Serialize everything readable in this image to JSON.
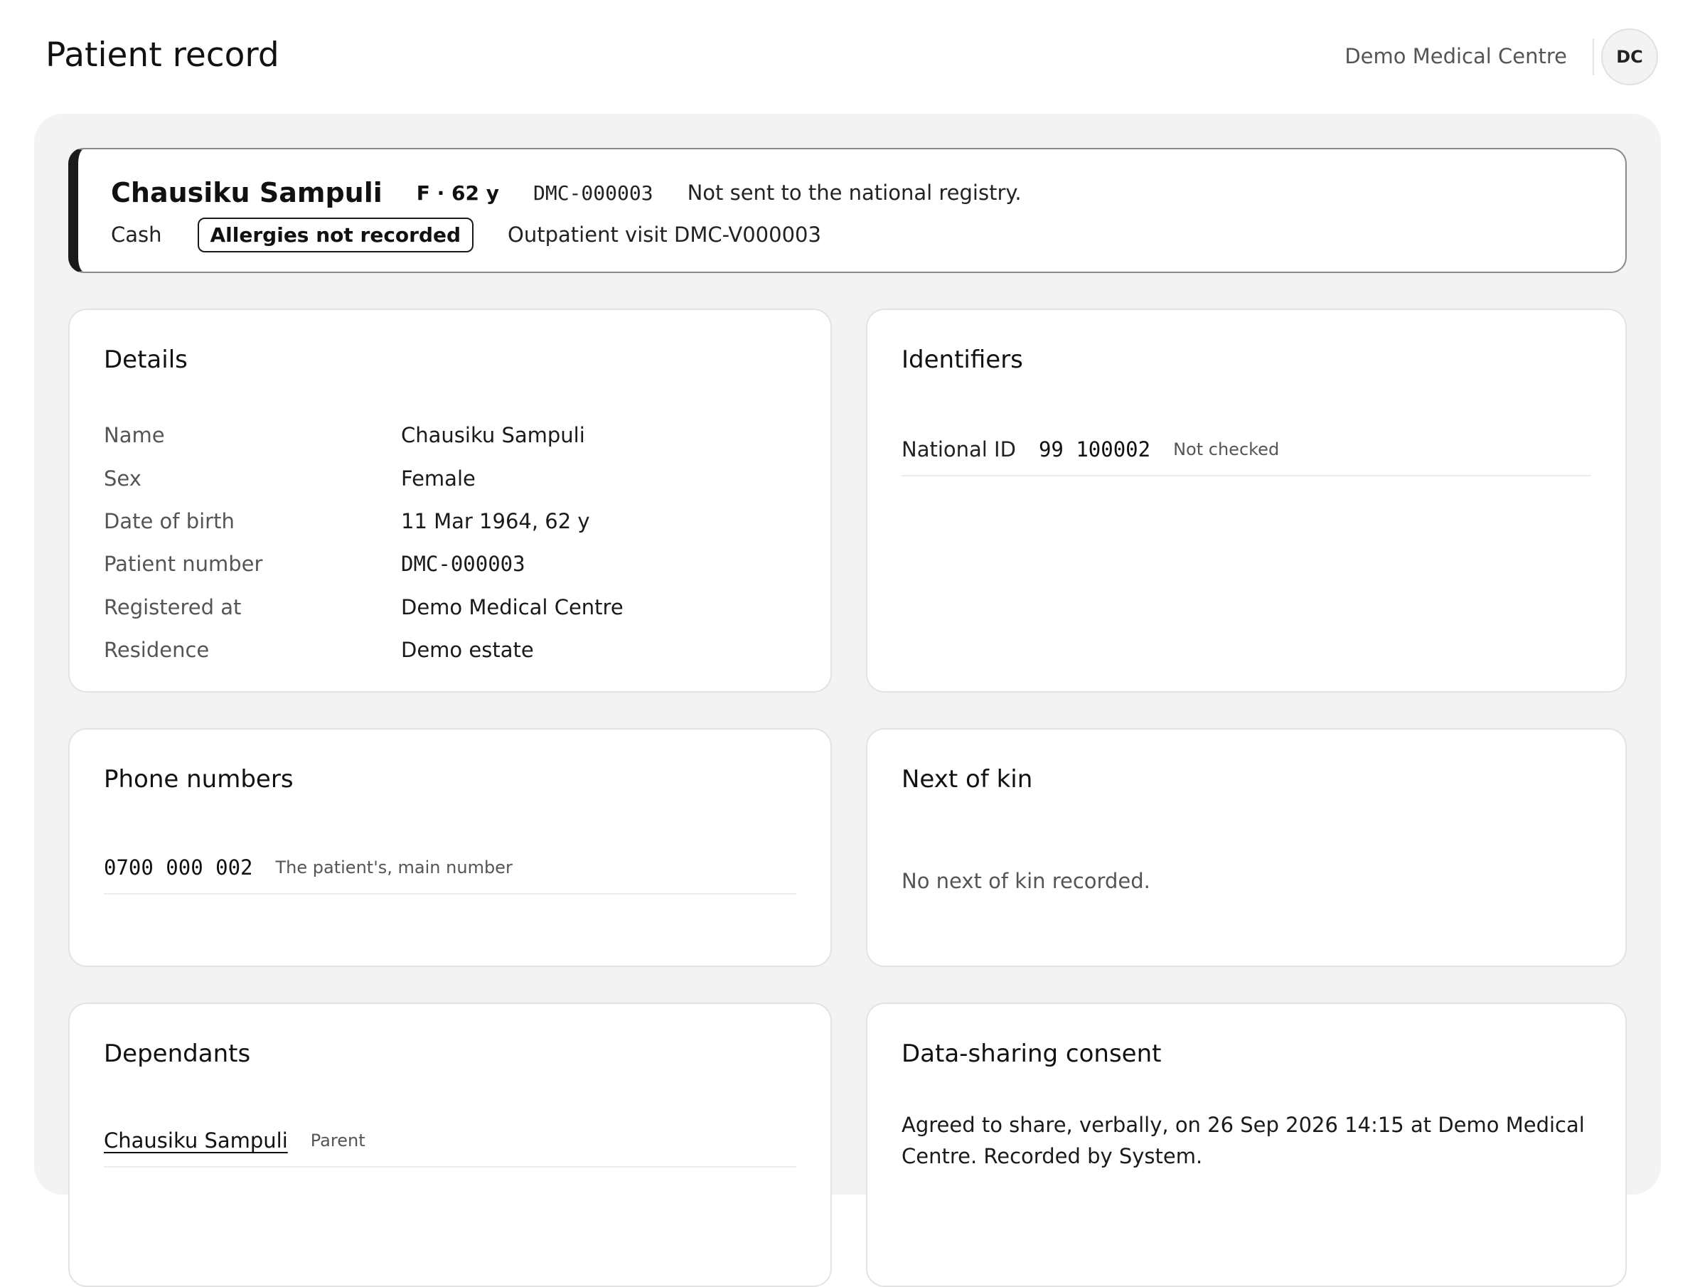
{
  "header": {
    "title": "Patient record",
    "org_name": "Demo Medical Centre",
    "avatar_initials": "DC"
  },
  "banner": {
    "patient_name": "Chausiku Sampuli",
    "sex_age": "F · 62 y",
    "patient_number": "DMC-000003",
    "registry_status": "Not sent to the national registry.",
    "payment": "Cash",
    "allergy_status": "Allergies not recorded",
    "visit": "Outpatient visit DMC-V000003",
    "accent_color": "#1a1a1a"
  },
  "details": {
    "title": "Details",
    "rows": [
      {
        "label": "Name",
        "value": "Chausiku Sampuli"
      },
      {
        "label": "Sex",
        "value": "Female"
      },
      {
        "label": "Date of birth",
        "value": "11 Mar 1964, 62 y"
      },
      {
        "label": "Patient number",
        "value": "DMC-000003"
      },
      {
        "label": "Registered at",
        "value": "Demo Medical Centre"
      },
      {
        "label": "Residence",
        "value": "Demo estate"
      }
    ]
  },
  "identifiers": {
    "title": "Identifiers",
    "items": [
      {
        "label": "National ID",
        "value": "99 100002",
        "status": "Not checked"
      }
    ]
  },
  "phones": {
    "title": "Phone numbers",
    "items": [
      {
        "number": "0700 000 002",
        "note": "The patient's, main number"
      }
    ]
  },
  "next_of_kin": {
    "title": "Next of kin",
    "empty_text": "No next of kin recorded."
  },
  "dependants": {
    "title": "Dependants",
    "items": [
      {
        "name": "Chausiku Sampuli",
        "relation": "Parent"
      }
    ]
  },
  "consent": {
    "title": "Data-sharing consent",
    "text": "Agreed to share, verbally, on 26 Sep 2026 14:15 at Demo Medical Centre. Recorded by System."
  }
}
